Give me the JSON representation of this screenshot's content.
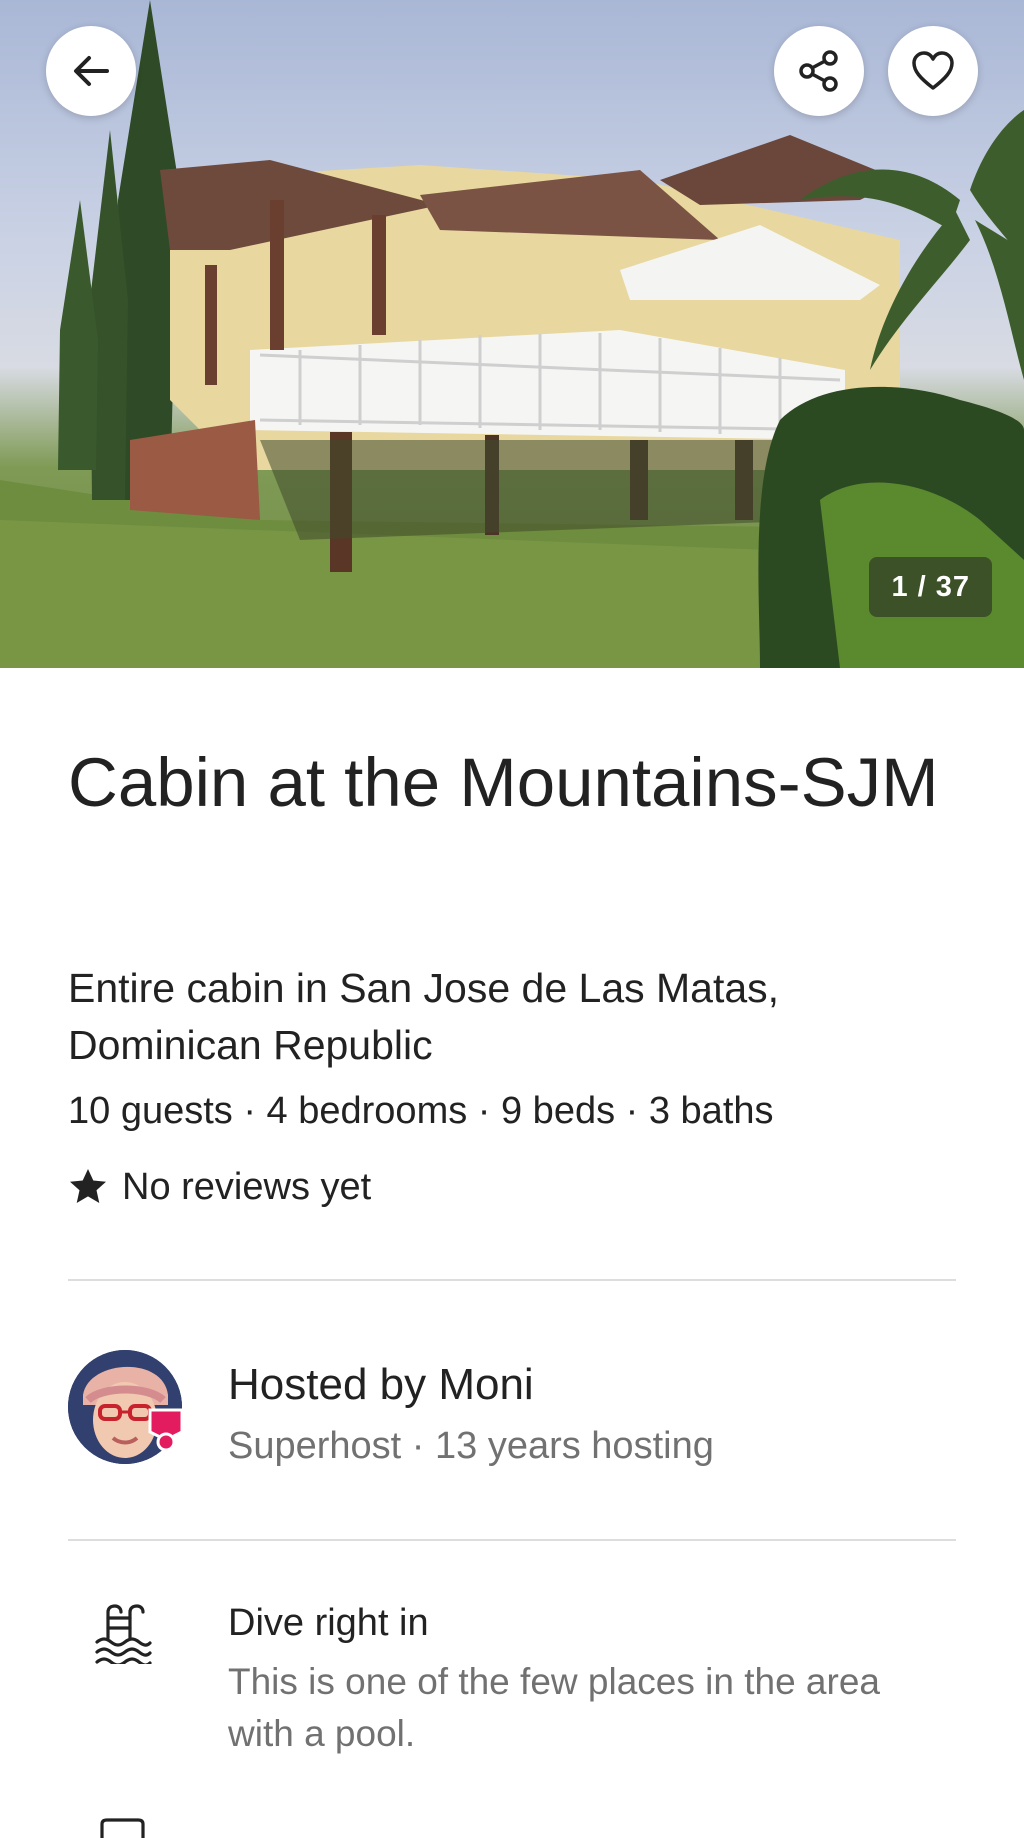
{
  "hero": {
    "photo_counter": "1 / 37",
    "icons": {
      "back": "arrow-left-icon",
      "share": "share-icon",
      "favorite": "heart-icon"
    }
  },
  "listing": {
    "title": "Cabin at the Mountains-SJM",
    "subtitle": "Entire cabin in San Jose de Las Matas, Dominican Republic",
    "details": "10 guests · 4 bedrooms · 9 beds · 3 baths",
    "reviews_text": "No reviews yet"
  },
  "host": {
    "name": "Hosted by Moni",
    "meta": "Superhost · 13 years hosting",
    "badge_color": "#e31c5f"
  },
  "highlights": [
    {
      "icon": "pool-icon",
      "title": "Dive right in",
      "description": "This is one of the few places in the area with a pool."
    }
  ]
}
